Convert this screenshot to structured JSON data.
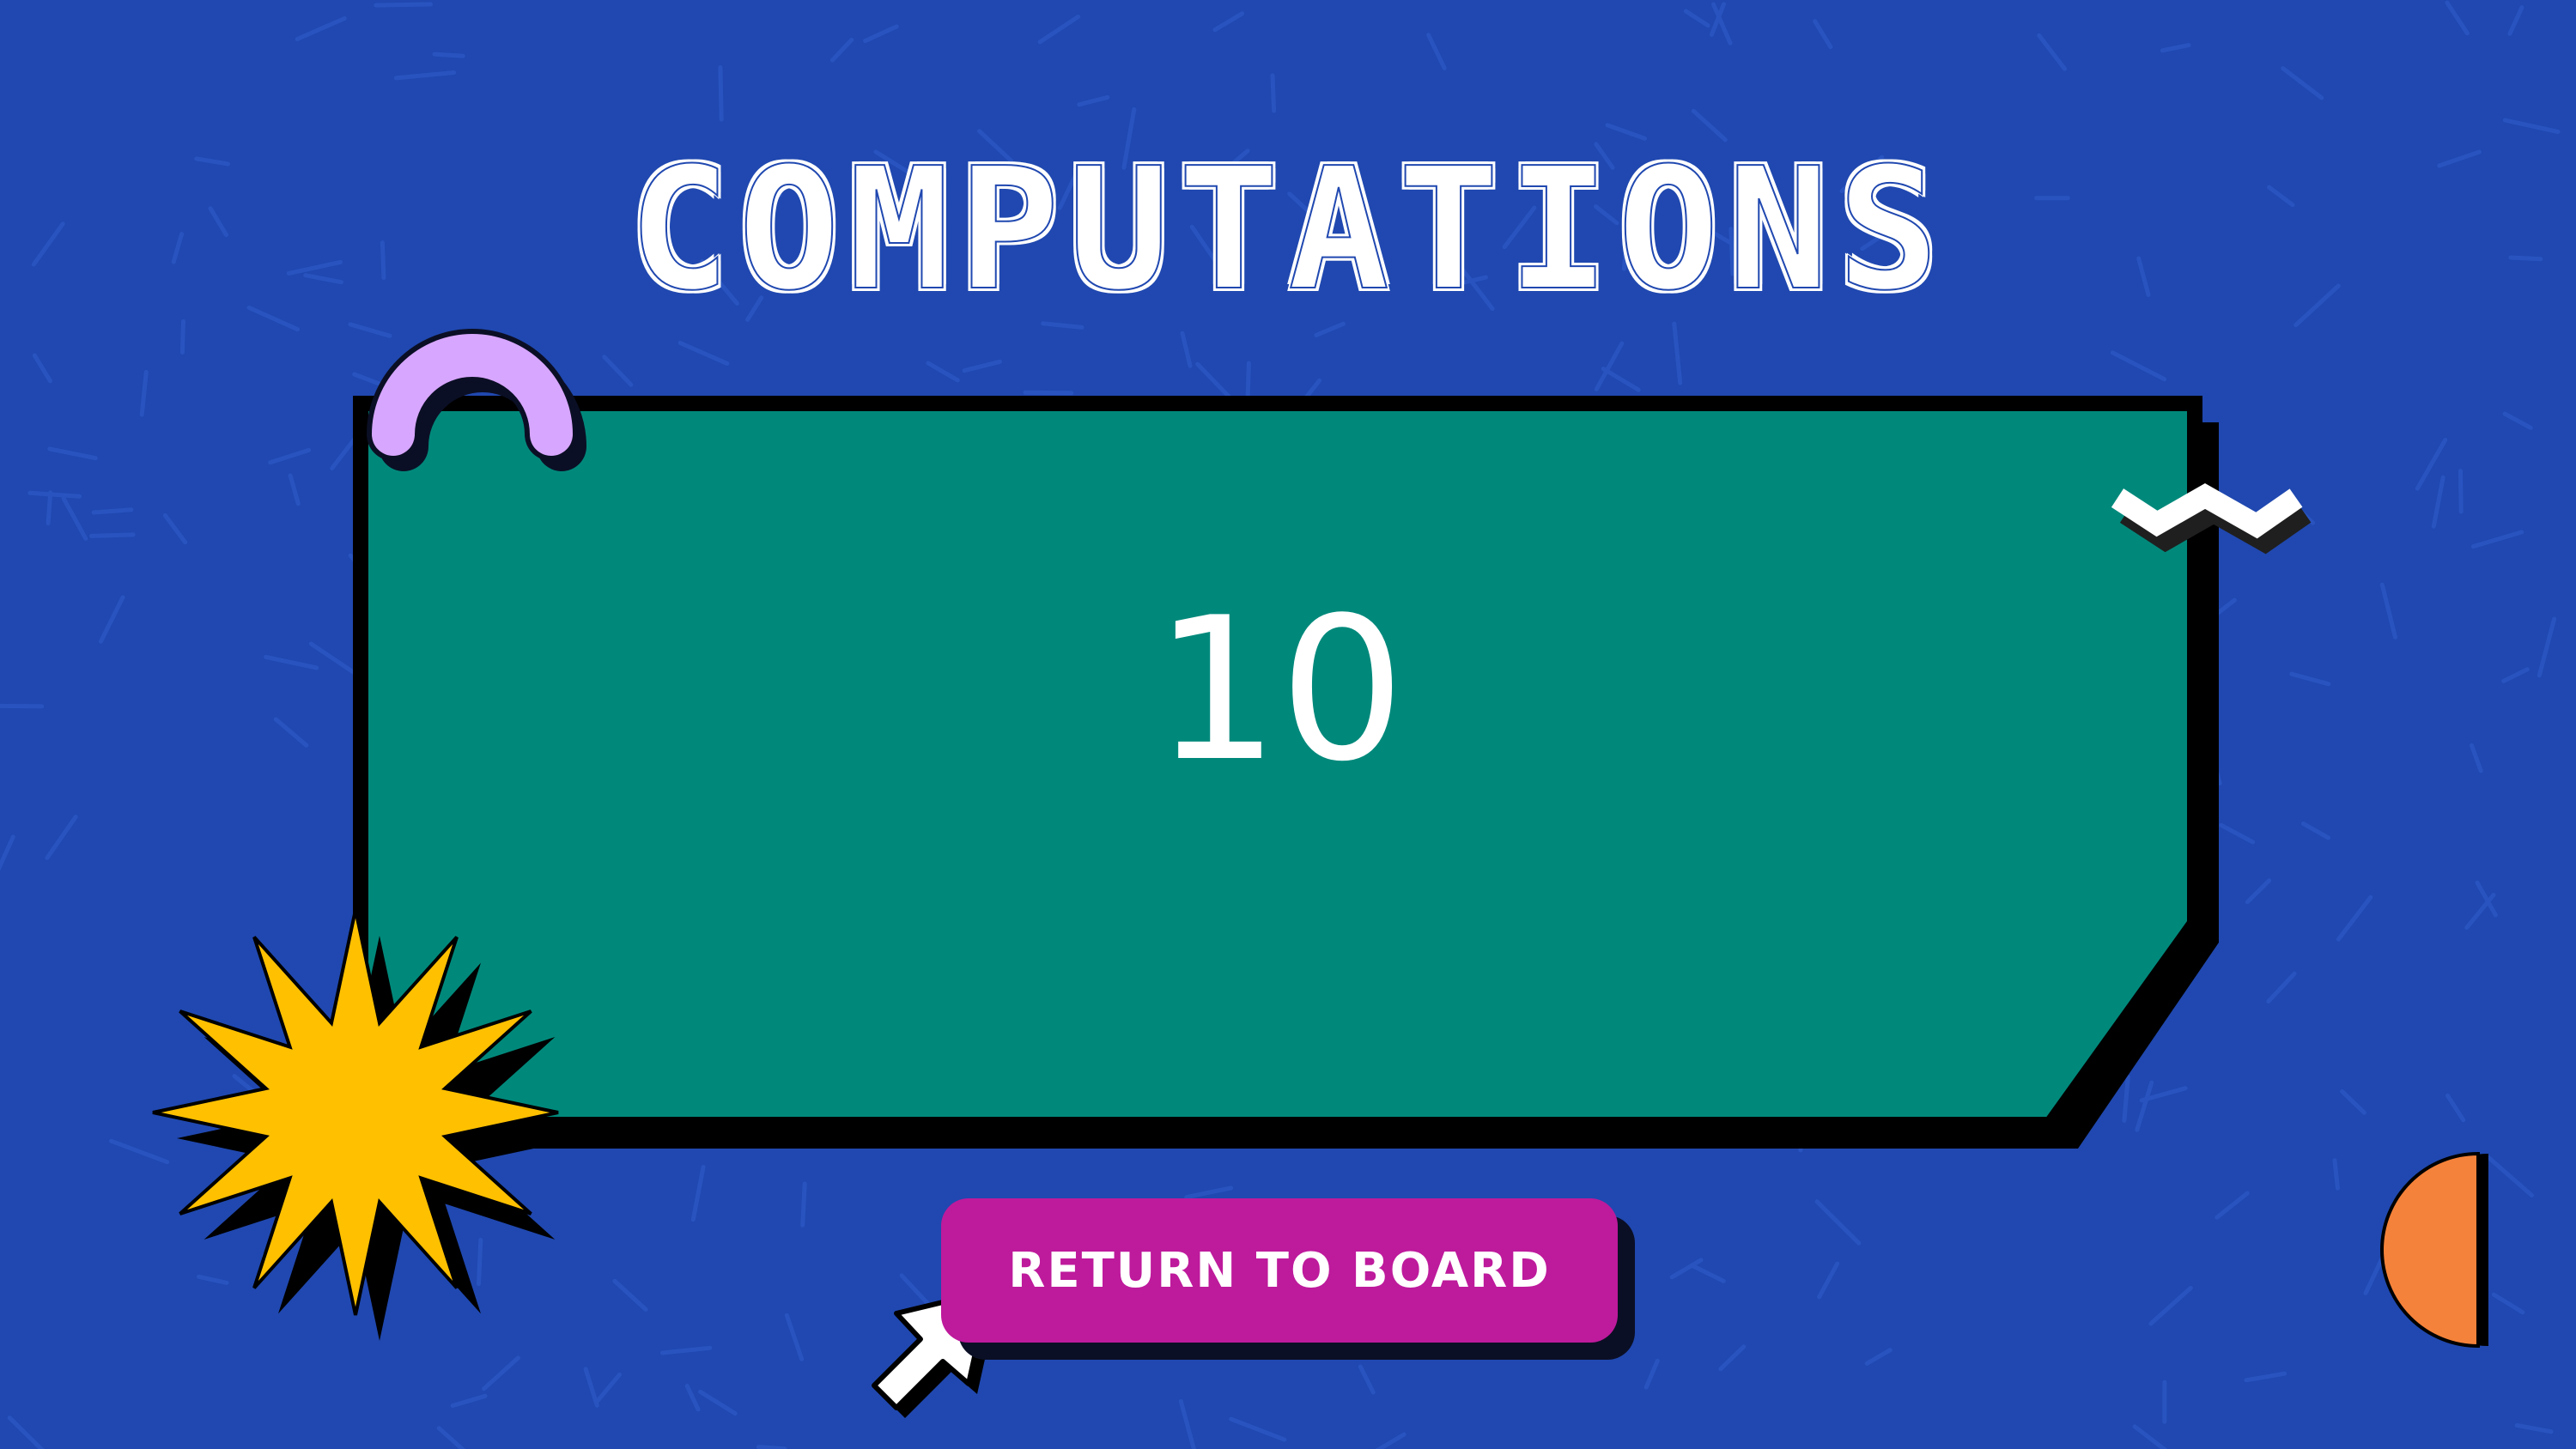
{
  "slide": {
    "title": "COMPUTATIONS",
    "answer": "10",
    "return_label": "RETURN TO BOARD"
  },
  "colors": {
    "background": "#2048b0",
    "panel": "#00897b",
    "shadow": "#000000",
    "button": "#be1a9c",
    "star": "#ffc000",
    "arch": "#d7a6ff",
    "half_circle": "#f5823a",
    "text": "#ffffff"
  },
  "icons": {
    "pointer": "cursor-arrow-icon",
    "star": "starburst-icon",
    "arch": "arch-icon",
    "zigzag": "zigzag-icon",
    "half_circle": "half-circle-icon"
  }
}
